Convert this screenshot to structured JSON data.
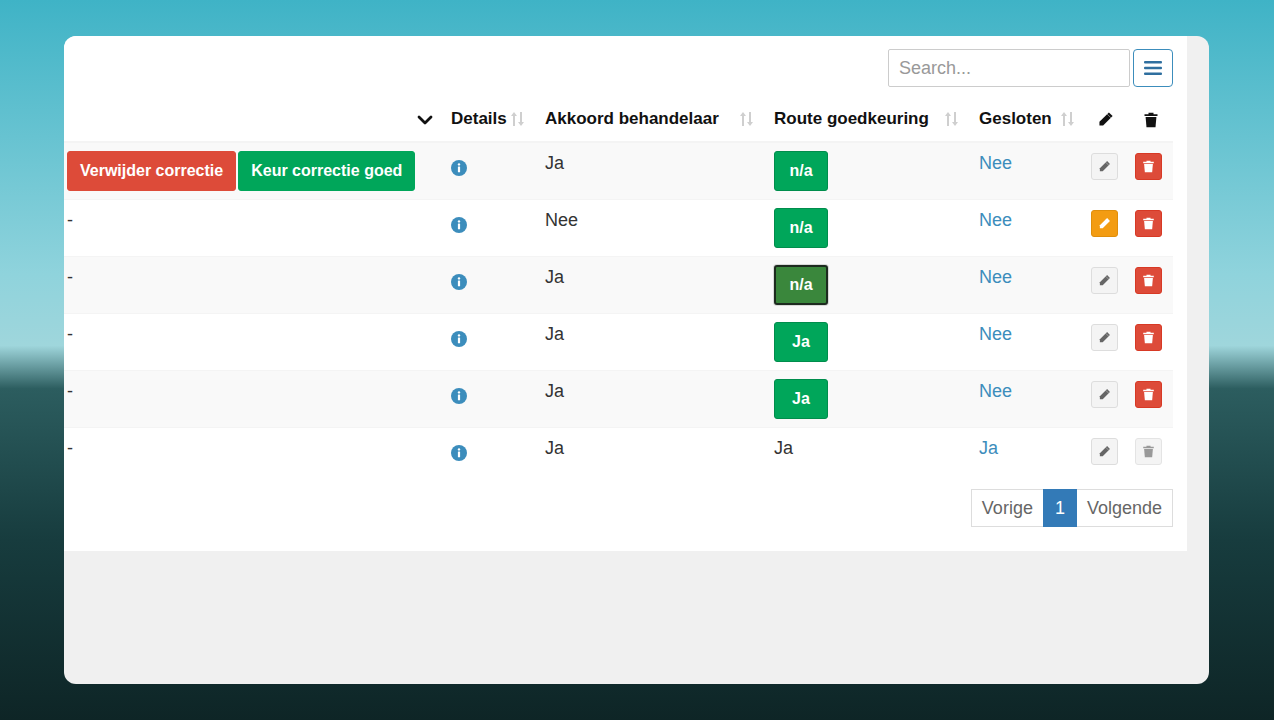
{
  "search": {
    "placeholder": "Search..."
  },
  "table": {
    "columns": [
      {
        "label": "Details"
      },
      {
        "label": "Akkoord behandelaar"
      },
      {
        "label": "Route goedkeuring"
      },
      {
        "label": "Gesloten"
      }
    ],
    "rows": [
      {
        "kind": "actions",
        "actions": [
          {
            "label": "Verwijder correctie",
            "color": "#dd4b39"
          },
          {
            "label": "Keur correctie goed",
            "color": "#00a65a"
          }
        ],
        "akkoord": "Ja",
        "route": {
          "kind": "button",
          "label": "n/a",
          "hovered": false
        },
        "gesloten": "Nee",
        "edit_warning": false,
        "delete_disabled": false
      },
      {
        "kind": "text",
        "text": "-",
        "akkoord": "Nee",
        "route": {
          "kind": "button",
          "label": "n/a",
          "hovered": false
        },
        "gesloten": "Nee",
        "edit_warning": true,
        "delete_disabled": false
      },
      {
        "kind": "text",
        "text": "-",
        "akkoord": "Ja",
        "route": {
          "kind": "button",
          "label": "n/a",
          "hovered": true
        },
        "gesloten": "Nee",
        "edit_warning": false,
        "delete_disabled": false
      },
      {
        "kind": "text",
        "text": "-",
        "akkoord": "Ja",
        "route": {
          "kind": "button",
          "label": "Ja",
          "hovered": false
        },
        "gesloten": "Nee",
        "edit_warning": false,
        "delete_disabled": false
      },
      {
        "kind": "text",
        "text": "-",
        "akkoord": "Ja",
        "route": {
          "kind": "button",
          "label": "Ja",
          "hovered": false
        },
        "gesloten": "Nee",
        "edit_warning": false,
        "delete_disabled": false
      },
      {
        "kind": "text",
        "text": "-",
        "akkoord": "Ja",
        "route": {
          "kind": "text",
          "label": "Ja",
          "hovered": false
        },
        "gesloten": "Ja",
        "edit_warning": false,
        "delete_disabled": true
      }
    ]
  },
  "pagination": {
    "items": [
      {
        "label": "Vorige",
        "selected": false
      },
      {
        "label": "1",
        "selected": true
      },
      {
        "label": "Volgende",
        "selected": false
      }
    ]
  }
}
